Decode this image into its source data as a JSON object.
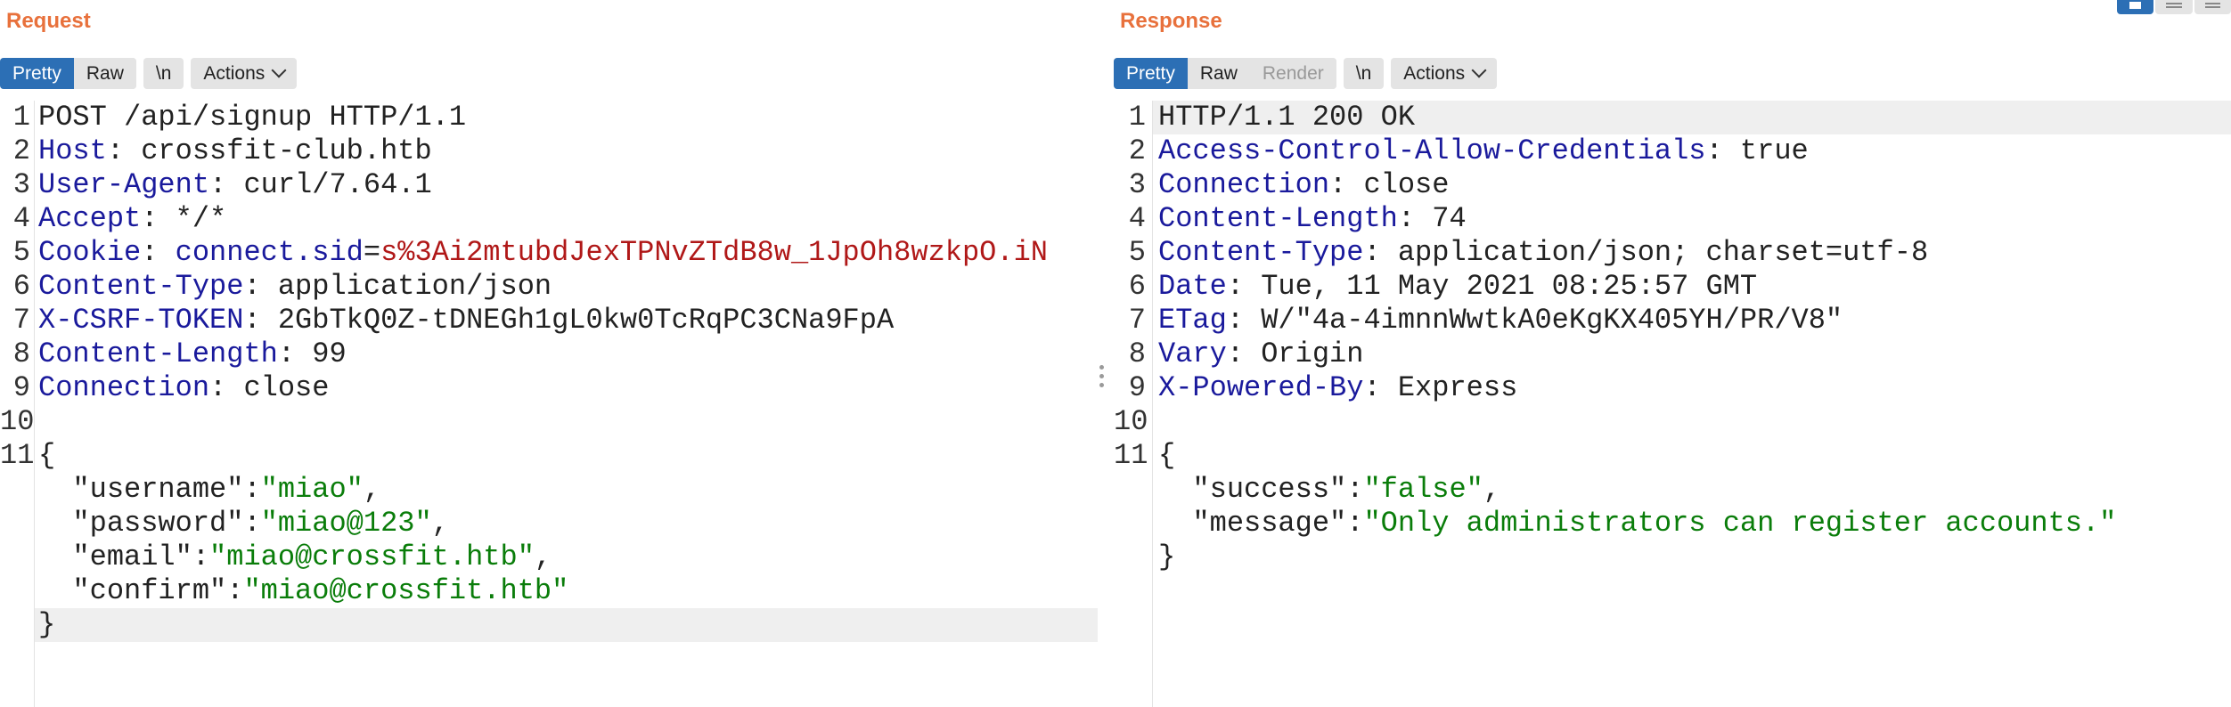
{
  "request": {
    "title": "Request",
    "tabs": {
      "pretty": "Pretty",
      "raw": "Raw",
      "newline": "\\n",
      "actions": "Actions"
    },
    "lines": [
      [
        {
          "t": "POST /api/signup HTTP/1.1",
          "c": "v"
        }
      ],
      [
        {
          "t": "Host",
          "c": "k"
        },
        {
          "t": ": crossfit-club.htb",
          "c": "v"
        }
      ],
      [
        {
          "t": "User-Agent",
          "c": "k"
        },
        {
          "t": ": curl/7.64.1",
          "c": "v"
        }
      ],
      [
        {
          "t": "Accept",
          "c": "k"
        },
        {
          "t": ": */*",
          "c": "v"
        }
      ],
      [
        {
          "t": "Cookie",
          "c": "k"
        },
        {
          "t": ": ",
          "c": "v"
        },
        {
          "t": "connect.sid",
          "c": "ca"
        },
        {
          "t": "=",
          "c": "v"
        },
        {
          "t": "s%3Ai2mtubdJexTPNvZTdB8w_1JpOh8wzkpO.iN",
          "c": "cv"
        }
      ],
      [
        {
          "t": "Content-Type",
          "c": "k"
        },
        {
          "t": ": application/json",
          "c": "v"
        }
      ],
      [
        {
          "t": "X-CSRF-TOKEN",
          "c": "k"
        },
        {
          "t": ": 2GbTkQ0Z-tDNEGh1gL0kw0TcRqPC3CNa9FpA",
          "c": "v"
        }
      ],
      [
        {
          "t": "Content-Length",
          "c": "k"
        },
        {
          "t": ": 99",
          "c": "v"
        }
      ],
      [
        {
          "t": "Connection",
          "c": "k"
        },
        {
          "t": ": close",
          "c": "v"
        }
      ],
      [],
      [
        {
          "t": "{",
          "c": "v"
        }
      ],
      [
        {
          "t": "  \"username\"",
          "c": "v"
        },
        {
          "t": ":",
          "c": "v"
        },
        {
          "t": "\"miao\"",
          "c": "s"
        },
        {
          "t": ",",
          "c": "v"
        }
      ],
      [
        {
          "t": "  \"password\"",
          "c": "v"
        },
        {
          "t": ":",
          "c": "v"
        },
        {
          "t": "\"miao@123\"",
          "c": "s"
        },
        {
          "t": ",",
          "c": "v"
        }
      ],
      [
        {
          "t": "  \"email\"",
          "c": "v"
        },
        {
          "t": ":",
          "c": "v"
        },
        {
          "t": "\"miao@crossfit.htb\"",
          "c": "s"
        },
        {
          "t": ",",
          "c": "v"
        }
      ],
      [
        {
          "t": "  \"confirm\"",
          "c": "v"
        },
        {
          "t": ":",
          "c": "v"
        },
        {
          "t": "\"miao@crossfit.htb\"",
          "c": "s"
        }
      ],
      [
        {
          "t": "}",
          "c": "v"
        }
      ]
    ],
    "line_numbers": [
      "1",
      "2",
      "3",
      "4",
      "5",
      "6",
      "7",
      "8",
      "9",
      "10",
      "11",
      "",
      "",
      "",
      "",
      ""
    ]
  },
  "response": {
    "title": "Response",
    "tabs": {
      "pretty": "Pretty",
      "raw": "Raw",
      "render": "Render",
      "newline": "\\n",
      "actions": "Actions"
    },
    "lines": [
      [
        {
          "t": "HTTP/1.1 200 OK",
          "c": "v"
        }
      ],
      [
        {
          "t": "Access-Control-Allow-Credentials",
          "c": "k"
        },
        {
          "t": ": true",
          "c": "v"
        }
      ],
      [
        {
          "t": "Connection",
          "c": "k"
        },
        {
          "t": ": close",
          "c": "v"
        }
      ],
      [
        {
          "t": "Content-Length",
          "c": "k"
        },
        {
          "t": ": 74",
          "c": "v"
        }
      ],
      [
        {
          "t": "Content-Type",
          "c": "k"
        },
        {
          "t": ": application/json; charset=utf-8",
          "c": "v"
        }
      ],
      [
        {
          "t": "Date",
          "c": "k"
        },
        {
          "t": ": Tue, 11 May 2021 08:25:57 GMT",
          "c": "v"
        }
      ],
      [
        {
          "t": "ETag",
          "c": "k"
        },
        {
          "t": ": W/\"4a-4imnnWwtkA0eKgKX405YH/PR/V8\"",
          "c": "v"
        }
      ],
      [
        {
          "t": "Vary",
          "c": "k"
        },
        {
          "t": ": Origin",
          "c": "v"
        }
      ],
      [
        {
          "t": "X-Powered-By",
          "c": "k"
        },
        {
          "t": ": Express",
          "c": "v"
        }
      ],
      [],
      [
        {
          "t": "{",
          "c": "v"
        }
      ],
      [
        {
          "t": "  \"success\"",
          "c": "v"
        },
        {
          "t": ":",
          "c": "v"
        },
        {
          "t": "\"false\"",
          "c": "s"
        },
        {
          "t": ",",
          "c": "v"
        }
      ],
      [
        {
          "t": "  \"message\"",
          "c": "v"
        },
        {
          "t": ":",
          "c": "v"
        },
        {
          "t": "\"Only administrators can register accounts.\"",
          "c": "s"
        }
      ],
      [
        {
          "t": "}",
          "c": "v"
        }
      ]
    ],
    "line_numbers": [
      "1",
      "2",
      "3",
      "4",
      "5",
      "6",
      "7",
      "8",
      "9",
      "10",
      "11",
      "",
      "",
      ""
    ]
  },
  "highlight": {
    "request_line": 15,
    "response_line": 0
  }
}
